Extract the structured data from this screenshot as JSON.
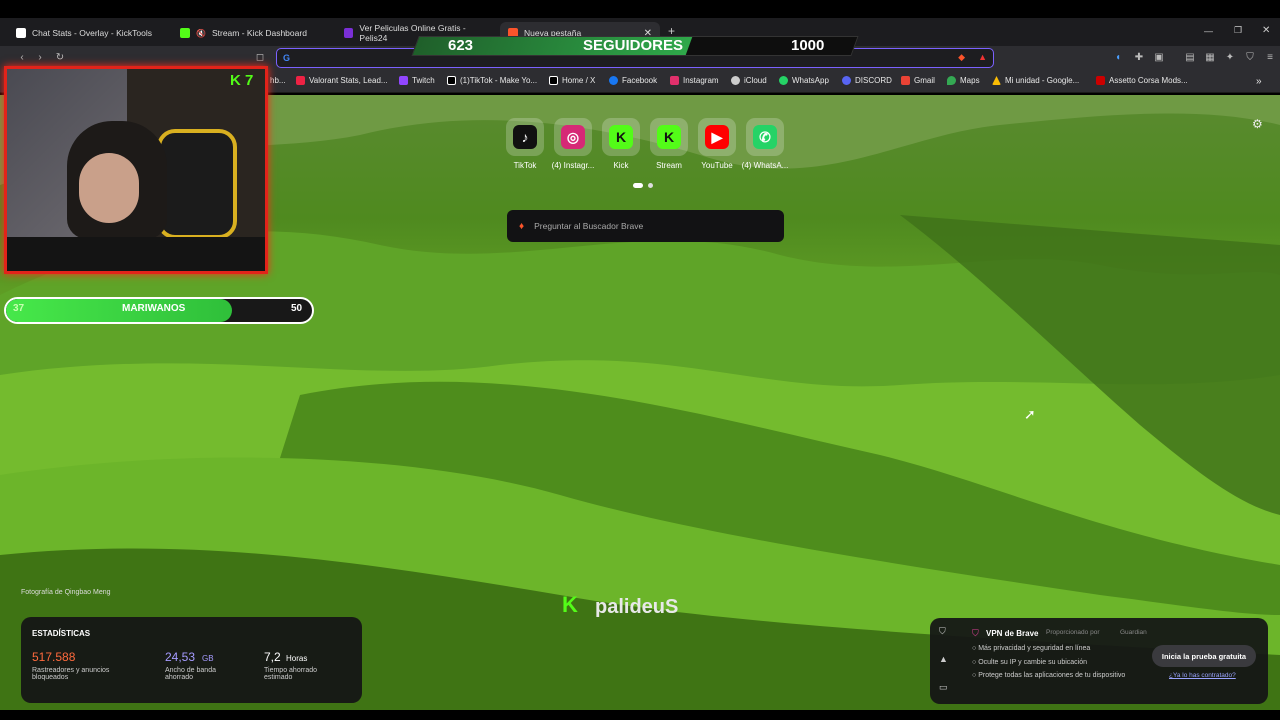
{
  "tabs": [
    {
      "label": "Chat Stats - Overlay - KickTools",
      "icon": "grid-icon",
      "color": "#ffffff"
    },
    {
      "label": "Stream - Kick Dashboard",
      "icon": "kick-icon",
      "color": "#53fc18"
    },
    {
      "label": "Ver Peliculas Online Gratis - Pelis24",
      "icon": "pelis24-icon",
      "color": "#7a2fd6"
    },
    {
      "label": "Nueva pestaña",
      "icon": "brave-icon",
      "color": "#fb542b"
    }
  ],
  "new_tab_symbol": "+",
  "omnibox": {
    "value": "",
    "placeholder": ""
  },
  "followers": {
    "current": "623",
    "label": "SEGUIDORES",
    "goal": "1000",
    "progress": 0.623
  },
  "bookmarks": [
    {
      "label": "hb...",
      "color": "#777"
    },
    {
      "label": "Valorant Stats, Lead...",
      "color": "#e24"
    },
    {
      "label": "Twitch",
      "color": "#9146ff"
    },
    {
      "label": "(1)TikTok - Make Yo...",
      "color": "#000"
    },
    {
      "label": "Home / X",
      "color": "#000"
    },
    {
      "label": "Facebook",
      "color": "#1877f2"
    },
    {
      "label": "Instagram",
      "color": "#e1306c"
    },
    {
      "label": "iCloud",
      "color": "#ccc"
    },
    {
      "label": "WhatsApp",
      "color": "#25d366"
    },
    {
      "label": "DISCORD",
      "color": "#5865f2"
    },
    {
      "label": "Gmail",
      "color": "#ea4335"
    },
    {
      "label": "Maps",
      "color": "#34a853"
    },
    {
      "label": "Mi unidad - Google...",
      "color": "#fbbc04"
    },
    {
      "label": "Assetto Corsa Mods...",
      "color": "#c00"
    }
  ],
  "cam_badge": "K 7",
  "goal_bar": {
    "current": "37",
    "label": "MARIWANOS",
    "target": "50",
    "progress": 0.74
  },
  "speed_dials": [
    {
      "label": "TikTok",
      "glyph": "♪",
      "color": "#111"
    },
    {
      "label": "(4) Instagr...",
      "glyph": "◎",
      "color": "#d62976"
    },
    {
      "label": "Kick",
      "glyph": "K",
      "color": "#53fc18"
    },
    {
      "label": "Stream",
      "glyph": "K",
      "color": "#53fc18"
    },
    {
      "label": "YouTube",
      "glyph": "▶",
      "color": "#ff0000"
    },
    {
      "label": "(4) WhatsA...",
      "glyph": "✆",
      "color": "#25d366"
    }
  ],
  "search_placeholder": "Preguntar al Buscador Brave",
  "photo_credit": "Fotografía de Qingbao Meng",
  "watermark": "palideuS",
  "stats": {
    "title": "ESTADÍSTICAS",
    "trackers_value": "517.588",
    "trackers_label": "Rastreadores y anuncios bloqueados",
    "bandwidth_value": "24,53",
    "bandwidth_unit": "GB",
    "bandwidth_label": "Ancho de banda ahorrado",
    "time_value": "7,2",
    "time_unit": "Horas",
    "time_label": "Tiempo ahorrado estimado"
  },
  "vpn": {
    "title": "VPN de Brave",
    "provider": "Proporcionado por",
    "provider_name": "Guardian",
    "features": [
      "Más privacidad y seguridad en línea",
      "Oculte su IP y cambie su ubicación",
      "Protege todas las aplicaciones de tu dispositivo"
    ],
    "cta": "Inicia la prueba gratuita",
    "link": "¿Ya lo has contratado?"
  }
}
